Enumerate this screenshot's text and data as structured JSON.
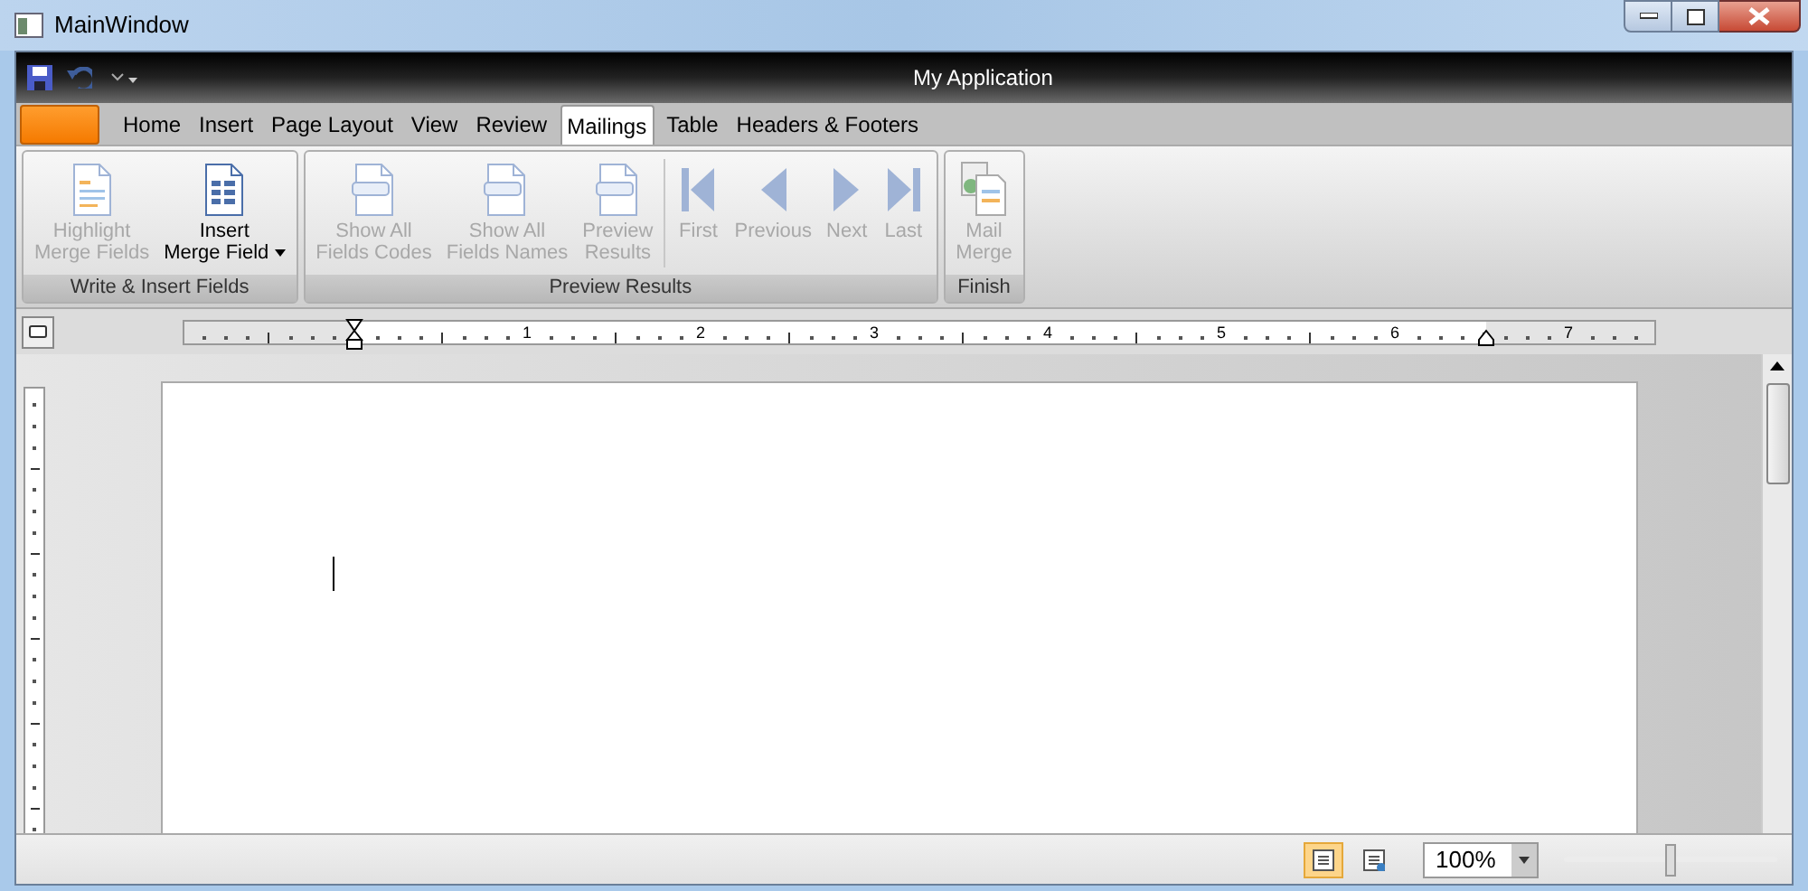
{
  "window": {
    "title": "MainWindow"
  },
  "app_title": "My Application",
  "tabs": [
    {
      "label": "Home",
      "selected": false
    },
    {
      "label": "Insert",
      "selected": false
    },
    {
      "label": "Page Layout",
      "selected": false
    },
    {
      "label": "View",
      "selected": false
    },
    {
      "label": "Review",
      "selected": false
    },
    {
      "label": "Mailings",
      "selected": true
    },
    {
      "label": "Table",
      "selected": false
    },
    {
      "label": "Headers & Footers",
      "selected": false
    }
  ],
  "ribbon_groups": [
    {
      "title": "Write & Insert Fields",
      "buttons": [
        {
          "kind": "highlight",
          "lines": [
            "Highlight",
            "Merge Fields"
          ],
          "disabled": true
        },
        {
          "kind": "insert",
          "lines": [
            "Insert",
            "Merge Field"
          ],
          "disabled": false,
          "dropdown": true
        }
      ]
    },
    {
      "title": "Preview Results",
      "buttons": [
        {
          "kind": "codes",
          "lines": [
            "Show All",
            "Fields Codes"
          ],
          "disabled": true
        },
        {
          "kind": "names",
          "lines": [
            "Show All",
            "Fields Names"
          ],
          "disabled": true
        },
        {
          "kind": "preview",
          "lines": [
            "Preview",
            "Results"
          ],
          "disabled": true
        },
        {
          "kind": "first",
          "lines": [
            "First"
          ],
          "disabled": true
        },
        {
          "kind": "previous",
          "lines": [
            "Previous"
          ],
          "disabled": true
        },
        {
          "kind": "next",
          "lines": [
            "Next"
          ],
          "disabled": true
        },
        {
          "kind": "last",
          "lines": [
            "Last"
          ],
          "disabled": true
        }
      ]
    },
    {
      "title": "Finish",
      "buttons": [
        {
          "kind": "merge",
          "lines": [
            "Mail",
            "Merge"
          ],
          "disabled": true
        }
      ]
    }
  ],
  "ruler": {
    "numbers": [
      "1",
      "2",
      "3",
      "4",
      "5",
      "6",
      "7"
    ]
  },
  "status_bar": {
    "views": [
      {
        "kind": "print",
        "selected": true
      },
      {
        "kind": "web",
        "selected": false
      }
    ],
    "zoom": "100%",
    "zoom_slider": {
      "level": 0.5
    }
  }
}
